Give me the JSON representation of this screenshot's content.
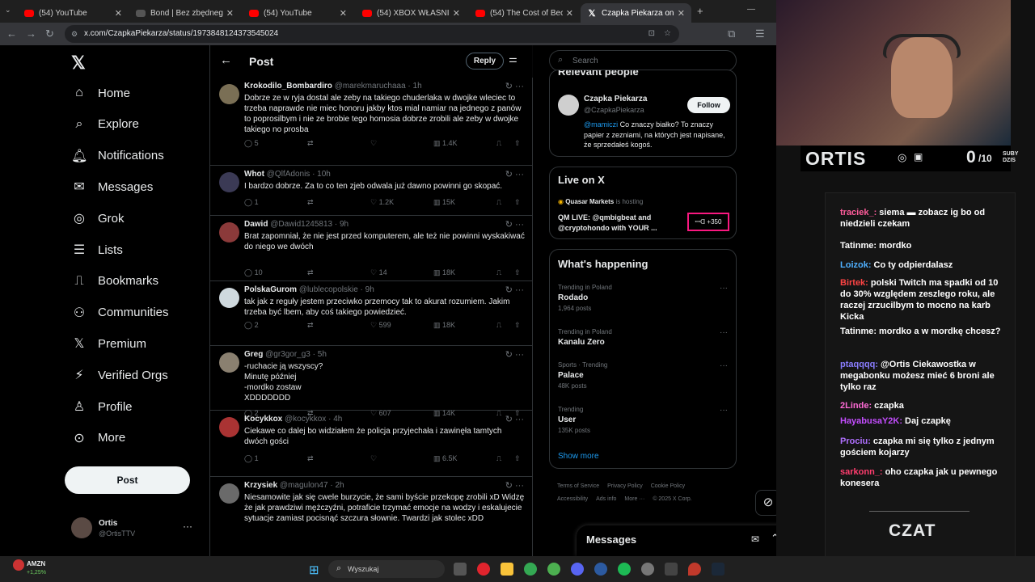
{
  "browser": {
    "tabs": [
      "(54) YouTube",
      "Bond | Bez zbędnego. | in...",
      "(54) YouTube",
      "(54) XBOX WŁAŚNIE WZM...",
      "(54) The Cost of Becomin...",
      "Czapka Piekarza on X: \"Po..."
    ],
    "url": "x.com/CzapkaPiekarza/status/1973848124373545024",
    "new_tab": "+"
  },
  "nav": {
    "logo": "𝕏",
    "items": [
      {
        "label": "Home",
        "icon": "home-icon",
        "glyph": "⌂"
      },
      {
        "label": "Explore",
        "icon": "search-icon",
        "glyph": "⌕"
      },
      {
        "label": "Notifications",
        "icon": "bell-icon",
        "glyph": "🔔︎"
      },
      {
        "label": "Messages",
        "icon": "mail-icon",
        "glyph": "✉"
      },
      {
        "label": "Grok",
        "icon": "grok-icon",
        "glyph": "◎"
      },
      {
        "label": "Lists",
        "icon": "list-icon",
        "glyph": "☰"
      },
      {
        "label": "Bookmarks",
        "icon": "bookmark-icon",
        "glyph": "⎍"
      },
      {
        "label": "Communities",
        "icon": "communities-icon",
        "glyph": "⚇"
      },
      {
        "label": "Premium",
        "icon": "x-premium-icon",
        "glyph": "𝕏"
      },
      {
        "label": "Verified Orgs",
        "icon": "lightning-icon",
        "glyph": "⚡︎"
      },
      {
        "label": "Profile",
        "icon": "profile-icon",
        "glyph": "♙"
      },
      {
        "label": "More",
        "icon": "more-icon",
        "glyph": "⊙"
      }
    ],
    "post_button": "Post",
    "user": {
      "name": "Ortis",
      "handle": "@OrtisTTV"
    }
  },
  "feed": {
    "title": "Post",
    "reply_button": "Reply",
    "tweets": [
      {
        "name": "Krokodilo_Bombardiro",
        "handle": "@marekmaruchaaa · 1h",
        "text": "Dobrze ze w ryja dostal ale zeby na takiego chuderlaka w dwojke wleciec to trzeba naprawde nie miec honoru jakby ktos mial namiar na jednego z panów to poprosilbym i nie ze brobie tego homosia dobrze zrobili ale zeby w dwojke takiego no prosba",
        "replies": "5",
        "likes": "",
        "views": "1.4K",
        "color": "#7a6f55"
      },
      {
        "name": "Whot",
        "handle": "@QlfAdonis · 10h",
        "text": "I bardzo dobrze. Za to co ten zjeb odwala już dawno powinni go skopać.",
        "replies": "1",
        "likes": "1.2K",
        "views": "15K",
        "color": "#3b3a55"
      },
      {
        "name": "Dawid",
        "handle": "@Dawid1245813 · 9h",
        "text": "Brat zapomniał, że nie jest przed komputerem, ale też nie powinni wyskakiwać do niego we dwóch",
        "replies": "10",
        "likes": "14",
        "views": "18K",
        "color": "#8b3a3a"
      },
      {
        "name": "PolskaGurom",
        "handle": "@lublecopolskie · 9h",
        "text": "tak jak z reguły jestem przeciwko przemocy tak to akurat rozumiem. Jakim trzeba być lbem, aby coś takiego powiedzieć.",
        "replies": "2",
        "likes": "599",
        "views": "18K",
        "color": "#cfd9de"
      },
      {
        "name": "Greg",
        "handle": "@gr3gor_g3 · 5h",
        "text": "-ruchacie ją wszyscy?\nMinutę później\n-mordko zostaw\nXDDDDDDD",
        "replies": "2",
        "likes": "607",
        "views": "14K",
        "color": "#8a8070"
      },
      {
        "name": "Kocykkox",
        "handle": "@kocykkox · 4h",
        "text": "Ciekawe co dalej bo widziałem że policja przyjechała i zawinęła tamtych dwóch gości",
        "replies": "1",
        "likes": "",
        "views": "6.5K",
        "color": "#aa3333"
      },
      {
        "name": "Krzysiek",
        "handle": "@magulon47 · 2h",
        "text": "Niesamowite jak się cwele burzycie, że sami byście przekopę zrobili xD Widzę że jak prawdziwi mężczyźni, potraficie trzymać emocje na wodzy i eskalujecie sytuacje zamiast pocisnąć szczura słownie. Twardzi jak stolec xDD",
        "replies": "",
        "likes": "",
        "views": "",
        "color": "#6a6a6a"
      }
    ]
  },
  "right": {
    "search_placeholder": "Search",
    "relevant_title": "Relevant people",
    "person": {
      "name": "Czapka Piekarza",
      "handle": "@CzapkaPiekarza",
      "follow": "Follow",
      "mention": "@mamiczi",
      "bio": " Co znaczy białko? To znaczy papier z zezniami, na których jest napisane, że sprzedałeś kogoś."
    },
    "live": {
      "title": "Live on X",
      "host": "Quasar Markets",
      "hosting": "is hosting",
      "desc": "QM LIVE: @qmbigbeat and @cryptohondo with YOUR ...",
      "count": "+350"
    },
    "happening": {
      "title": "What's happening",
      "trends": [
        {
          "kicker": "Trending in Poland",
          "topic": "Rodado",
          "count": "1,964 posts"
        },
        {
          "kicker": "Trending in Poland",
          "topic": "Kanalu Zero",
          "count": ""
        },
        {
          "kicker": "Sports · Trending",
          "topic": "Palace",
          "count": "48K posts"
        },
        {
          "kicker": "Trending",
          "topic": "User",
          "count": "135K posts"
        }
      ],
      "show_more": "Show more"
    },
    "footer": [
      "Terms of Service",
      "Privacy Policy",
      "Cookie Policy",
      "Accessibility",
      "Ads info",
      "More ···",
      "© 2025 X Corp."
    ],
    "messages_title": "Messages"
  },
  "stream": {
    "brand": "ORTIS",
    "subs": "0",
    "subs_total": "/10",
    "subs_label1": "SUBY",
    "subs_label2": "DZIS",
    "chat_title": "CZAT",
    "chat": [
      {
        "user": "traciek_:",
        "color": "#ff5c9b",
        "text": "siema ▬ zobacz ig bo od niedzieli czekam"
      },
      {
        "user": "Tatinme:",
        "color": "#ffffff",
        "text": "mordko"
      },
      {
        "user": "Loizok:",
        "color": "#4fb0ff",
        "text": "Co ty odpierdalasz"
      },
      {
        "user": "Birtek:",
        "color": "#ff4444",
        "text": "polski Twitch ma spadki od 10 do 30% względem zeszlego roku, ale raczej zrzucilbym to mocno na karb Kicka"
      },
      {
        "user": "Tatinme:",
        "color": "#ffffff",
        "text": "mordko a w mordkę chcesz?"
      },
      {
        "user": "ptaqqqq:",
        "color": "#8a7dff",
        "text": "@Ortis Ciekawostka w megabonku możesz mieć 6 broni ale tylko raz"
      },
      {
        "user": "2Linde:",
        "color": "#ff6bd6",
        "text": "czapka"
      },
      {
        "user": "HayabusaY2K:",
        "color": "#c44dff",
        "text": "Daj czapkę"
      },
      {
        "user": "Prociu:",
        "color": "#b070ff",
        "text": "czapka mi się tylko z jednym gościem kojarzy"
      },
      {
        "user": "sarkonn_:",
        "color": "#ff3d6e",
        "text": "oho czapka jak u pewnego konesera"
      }
    ]
  },
  "taskbar": {
    "ticker": "AMZN",
    "change": "+1,25%",
    "search": "Wyszukaj"
  }
}
